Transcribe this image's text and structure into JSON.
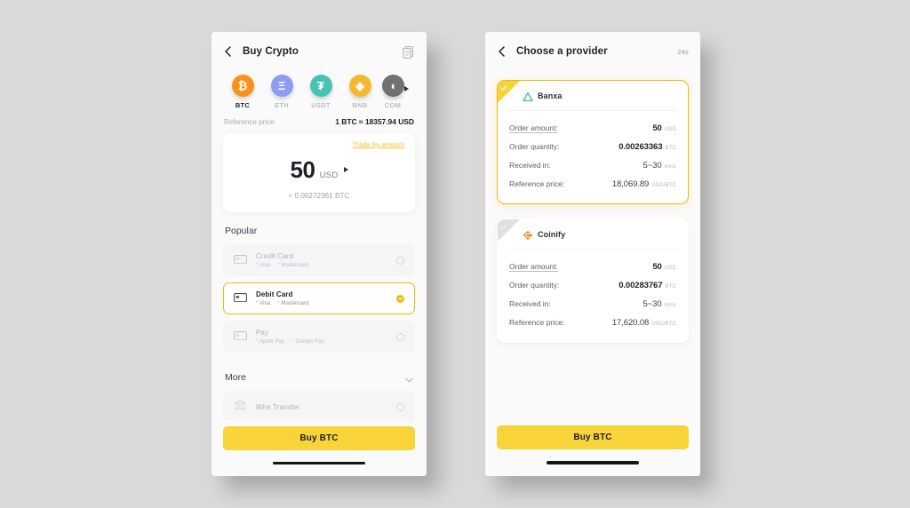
{
  "theme": {
    "brand_yellow": "#f8d33a",
    "link_yellow": "#f0b90b",
    "page_bg": "#d9d9d9",
    "phone_bg": "#fafafa"
  },
  "left_screen": {
    "header": {
      "back_icon": "chevron-left-icon",
      "title": "Buy Crypto",
      "action_icon": "order-history-icon"
    },
    "coins": [
      {
        "symbol": "BTC",
        "glyph": "₿",
        "color": "#f7931a",
        "active": true,
        "truncated": false
      },
      {
        "symbol": "ETH",
        "glyph": "Ξ",
        "color": "#8c9cf0",
        "active": false,
        "truncated": false
      },
      {
        "symbol": "USDT",
        "glyph": "₮",
        "color": "#46c3b2",
        "active": false,
        "truncated": false
      },
      {
        "symbol": "BNB",
        "glyph": "◈",
        "color": "#f3ba2f",
        "active": false,
        "truncated": false
      },
      {
        "symbol": "COM",
        "glyph": "◖",
        "color": "#4a4f57",
        "active": false,
        "truncated": true
      }
    ],
    "scroll_arrow_icon": "caret-right-icon",
    "reference": {
      "label": "Reference price:",
      "value": "1 BTC ≈ 18357.94 USD"
    },
    "amount_card": {
      "trade_link": "Trade by amount",
      "amount": "50",
      "currency": "USD",
      "currency_caret_icon": "caret-right-icon",
      "converted": "≈ 0.00272361 BTC"
    },
    "popular": {
      "title": "Popular"
    },
    "payment_methods": [
      {
        "name": "Credit Card",
        "icon": "credit-card-icon",
        "tags": [
          "° Visa",
          "° Mastercard"
        ],
        "selected": false
      },
      {
        "name": "Debit Card",
        "icon": "credit-card-icon",
        "tags": [
          "° Visa",
          "° Mastercard"
        ],
        "selected": true
      },
      {
        "name": "Pay",
        "icon": "credit-card-icon",
        "tags": [
          "° Apple Pay",
          "° Google Pay"
        ],
        "selected": false
      }
    ],
    "more": {
      "title": "More",
      "chevron_icon": "chevron-down-icon"
    },
    "more_methods": [
      {
        "name": "Wire Transfer",
        "icon": "bank-icon",
        "tags": [],
        "selected": false
      }
    ],
    "buy_button": "Buy BTC"
  },
  "right_screen": {
    "header": {
      "back_icon": "chevron-left-icon",
      "title": "Choose a provider",
      "timer": "24s"
    },
    "providers": [
      {
        "name": "Banxa",
        "logo_icon": "banxa-triangle-icon",
        "logo_color": "#4fc3b0",
        "selected": true,
        "ribbon_icon": "check-icon",
        "rows": [
          {
            "label": "Order amount:",
            "value": "50",
            "unit": "USD",
            "underline": true,
            "bold": true
          },
          {
            "label": "Order quantity:",
            "value": "0.00263363",
            "unit": "BTC",
            "underline": false,
            "bold": true
          },
          {
            "label": "Received in:",
            "value": "5~30",
            "unit": "mins",
            "underline": false,
            "bold": false
          },
          {
            "label": "Reference price:",
            "value": "18,069.89",
            "unit": "USD/BTC",
            "underline": false,
            "bold": false
          }
        ]
      },
      {
        "name": "Coinify",
        "logo_icon": "coinify-diamond-icon",
        "logo_color": "#f2821f",
        "selected": false,
        "ribbon_icon": "check-icon",
        "rows": [
          {
            "label": "Order amount:",
            "value": "50",
            "unit": "USD",
            "underline": true,
            "bold": true
          },
          {
            "label": "Order quantity:",
            "value": "0.00283767",
            "unit": "BTC",
            "underline": false,
            "bold": true
          },
          {
            "label": "Received in:",
            "value": "5~30",
            "unit": "mins",
            "underline": false,
            "bold": false
          },
          {
            "label": "Reference price:",
            "value": "17,620.08",
            "unit": "USD/BTC",
            "underline": false,
            "bold": false
          }
        ]
      }
    ],
    "buy_button": "Buy BTC"
  }
}
